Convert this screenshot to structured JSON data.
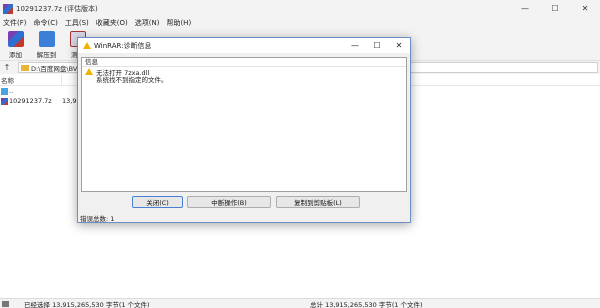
{
  "window": {
    "title": "10291237.7z (评估版本)"
  },
  "menu": [
    "文件(F)",
    "命令(C)",
    "工具(S)",
    "收藏夹(O)",
    "选项(N)",
    "帮助(H)"
  ],
  "toolbar": [
    {
      "label": "添加",
      "icon": "add-archive-icon",
      "color": "#c0392b"
    },
    {
      "label": "解压到",
      "icon": "extract-to-icon",
      "color": "#2e6fd1"
    },
    {
      "label": "测试",
      "icon": "test-icon",
      "color": "#9b59b6"
    }
  ],
  "address": {
    "path": "D:\\百度网盘\\BV"
  },
  "list": {
    "column_name": "名称",
    "rows": [
      {
        "name": "..",
        "size": ""
      },
      {
        "name": "10291237.7z",
        "size": "13,9"
      }
    ]
  },
  "status": {
    "left": "已经选择 13,915,265,530 字节(1 个文件)",
    "right": "总计 13,915,265,530 字节(1 个文件)"
  },
  "dialog": {
    "title": "WinRAR:诊断信息",
    "list_header": "信息",
    "message1": "无法打开 7zxa.dll",
    "message2": "系统找不到指定的文件。",
    "buttons": {
      "close": "关闭(C)",
      "abort": "中断操作(B)",
      "copy": "复制到剪贴板(L)"
    },
    "error_total": "错误总数: 1"
  }
}
